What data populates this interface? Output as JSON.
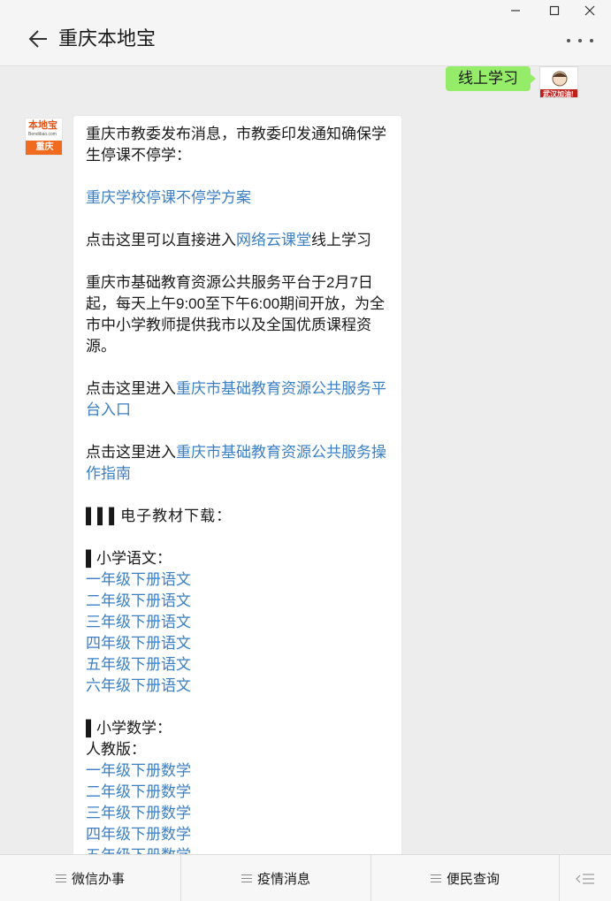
{
  "window": {
    "minimize_icon": "minimize-icon",
    "maximize_icon": "maximize-icon",
    "close_icon": "close-icon"
  },
  "header": {
    "title": "重庆本地宝",
    "back_icon": "arrow-left-icon",
    "more_icon": "more-dots-icon"
  },
  "self_message": {
    "text": "线上学习",
    "avatar_text": "武汉加油!"
  },
  "sender_avatar": {
    "logo": "本地宝",
    "sub": "Bendibao.com",
    "city": "重庆"
  },
  "message": {
    "intro": "重庆市教委发布消息，市教委印发通知确保学生停课不停学：",
    "plan_link": "重庆学校停课不停学方案",
    "cloud_prefix": "点击这里可以直接进入",
    "cloud_link": "网络云课堂",
    "cloud_suffix": "线上学习",
    "platform_info": "重庆市基础教育资源公共服务平台于2月7日起，每天上午9:00至下午6:00期间开放，为全市中小学教师提供我市以及全国优质课程资源。",
    "entry_prefix": "点击这里进入",
    "entry_link": "重庆市基础教育资源公共服务平台入口",
    "guide_prefix": "点击这里进入",
    "guide_link": "重庆市基础教育资源公共服务操作指南",
    "textbook_heading": "▌▌▌电子教材下载：",
    "chinese_heading": "▌小学语文：",
    "chinese_links": [
      "一年级下册语文",
      "二年级下册语文",
      "三年级下册语文",
      "四年级下册语文",
      "五年级下册语文",
      "六年级下册语文"
    ],
    "math_heading": "▌小学数学：",
    "math_edition": "人教版：",
    "math_links": [
      "一年级下册数学",
      "二年级下册数学",
      "三年级下册数学",
      "四年级下册数学",
      "五年级下册数学"
    ]
  },
  "bottom_menu": {
    "items": [
      "微信办事",
      "疫情消息",
      "便民查询"
    ],
    "keyboard_icon": "keyboard-toggle-icon"
  },
  "colors": {
    "link": "#3b7fc4",
    "self_bubble": "#95ec69",
    "background": "#ededed"
  }
}
